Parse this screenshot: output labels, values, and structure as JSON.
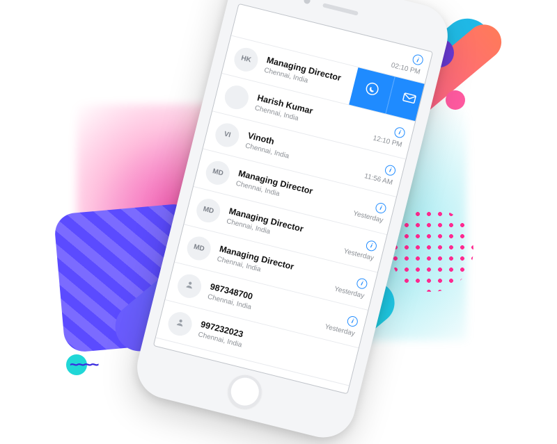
{
  "accent": "#1f8bff",
  "head": {
    "time": "02:10 PM"
  },
  "rows": [
    {
      "initials": "HK",
      "name": "Managing Director",
      "location": "Chennai, India",
      "swiped": true
    },
    {
      "initials": "",
      "name": "Harish Kumar",
      "location": "Chennai, India",
      "time": "12:10 PM"
    },
    {
      "initials": "VI",
      "name": "Vinoth",
      "location": "Chennai, India",
      "time": "11:56 AM"
    },
    {
      "initials": "MD",
      "name": "Managing Director",
      "location": "Chennai, India",
      "time": "Yesterday"
    },
    {
      "initials": "MD",
      "name": "Managing Director",
      "location": "Chennai, India",
      "time": "Yesterday"
    },
    {
      "initials": "MD",
      "name": "Managing Director",
      "location": "Chennai, India",
      "time": "Yesterday"
    },
    {
      "initials": "",
      "name": "987348700",
      "location": "Chennai, India",
      "time": "Yesterday",
      "icon": "person"
    },
    {
      "initials": "",
      "name": "997232023",
      "location": "Chennai, India",
      "time": "",
      "icon": "person"
    }
  ],
  "actions": {
    "whatsapp": "whatsapp-icon",
    "mail": "mail-icon"
  }
}
